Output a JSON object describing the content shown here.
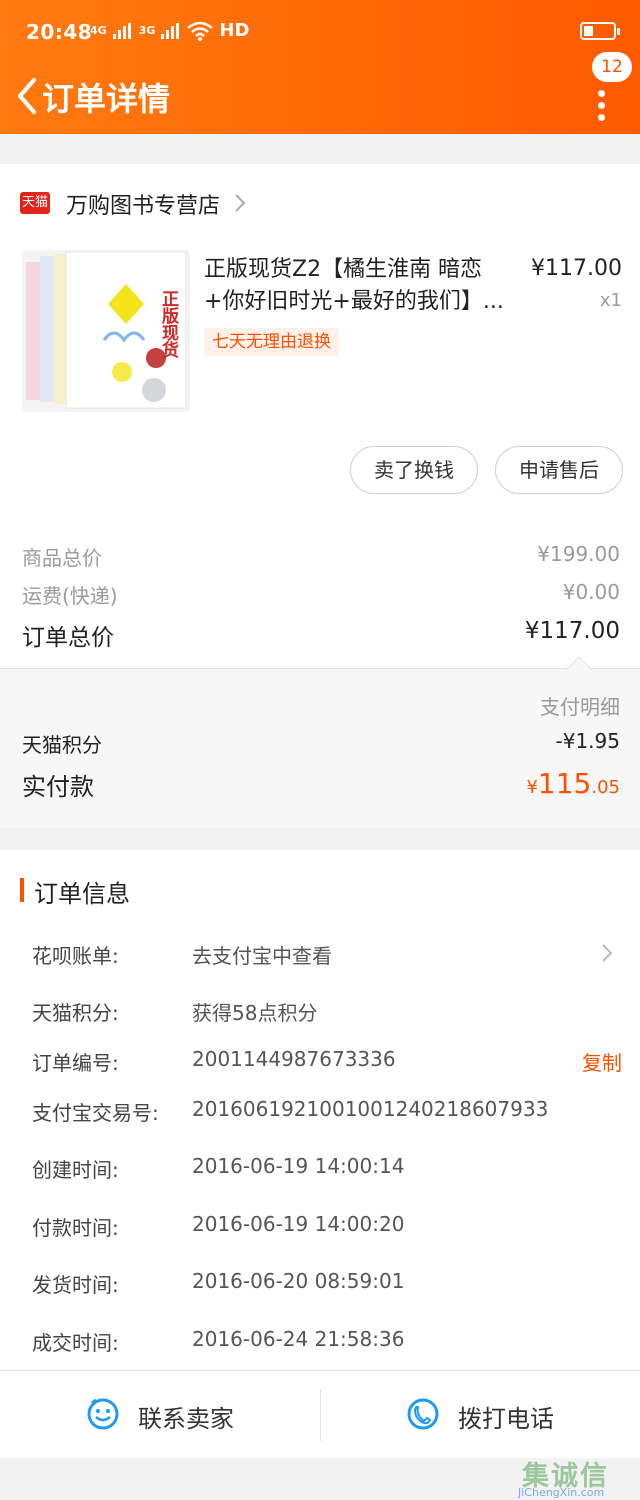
{
  "status_bar": {
    "time": "20:48",
    "net1": "4G",
    "net2": "3G",
    "hd": "HD"
  },
  "header": {
    "title": "订单详情",
    "badge": "12"
  },
  "store": {
    "logo_text": "天猫",
    "name": "万购图书专营店"
  },
  "product": {
    "name": "正版现货Z2【橘生淮南 暗恋+你好旧时光+最好的我们】...",
    "price": "¥117.00",
    "qty": "x1",
    "tag": "七天无理由退换",
    "cover_text": "正版现货"
  },
  "actions": {
    "sell": "卖了换钱",
    "after_sale": "申请售后"
  },
  "summary": {
    "goods_label": "商品总价",
    "goods_value": "¥199.00",
    "shipping_label": "运费(快递)",
    "shipping_value": "¥0.00",
    "total_label": "订单总价",
    "total_value": "¥117.00"
  },
  "payment": {
    "detail_link": "支付明细",
    "points_label": "天猫积分",
    "points_value": "-¥1.95",
    "paid_label": "实付款",
    "paid_symbol": "¥",
    "paid_int": "115",
    "paid_dec": ".05"
  },
  "order_info": {
    "title": "订单信息",
    "rows": [
      {
        "key": "花呗账单:",
        "value": "去支付宝中查看"
      },
      {
        "key": "天猫积分:",
        "value": "获得58点积分"
      },
      {
        "key": "订单编号:",
        "value": "2001144987673336",
        "action": "复制"
      },
      {
        "key": "支付宝交易号:",
        "value": "2016061921001001240218607933"
      },
      {
        "key": "创建时间:",
        "value": "2016-06-19 14:00:14"
      },
      {
        "key": "付款时间:",
        "value": "2016-06-19 14:00:20"
      },
      {
        "key": "发货时间:",
        "value": "2016-06-20 08:59:01"
      },
      {
        "key": "成交时间:",
        "value": "2016-06-24 21:58:36"
      }
    ]
  },
  "footer": {
    "contact": "联系卖家",
    "call": "拨打电话"
  },
  "watermark": {
    "text": "集诚信",
    "url": "JiChengXin.com"
  },
  "colors": {
    "accent": "#ff5000",
    "header_start": "#ff7a10",
    "header_end": "#ff5a00"
  }
}
